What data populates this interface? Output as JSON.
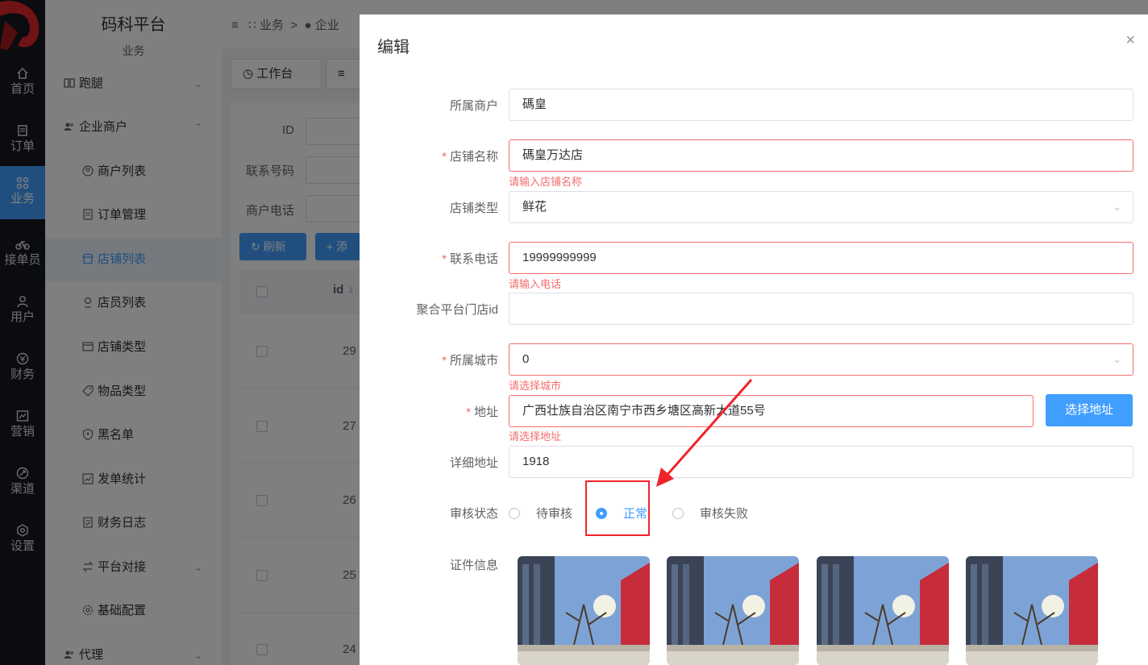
{
  "rail": {
    "items": [
      {
        "label": "首页",
        "icon": "home-icon"
      },
      {
        "label": "订单",
        "icon": "order-icon"
      },
      {
        "label": "业务",
        "icon": "grid-icon",
        "active": true
      },
      {
        "label": "接单员",
        "icon": "bike-icon"
      },
      {
        "label": "用户",
        "icon": "user-icon"
      },
      {
        "label": "财务",
        "icon": "finance-icon"
      },
      {
        "label": "营销",
        "icon": "chart-icon"
      },
      {
        "label": "渠道",
        "icon": "channel-icon"
      },
      {
        "label": "设置",
        "icon": "settings-icon"
      }
    ]
  },
  "sidebar": {
    "title": "码科平台",
    "subtitle": "业务",
    "groups": {
      "errand": "跑腿",
      "enterprise": "企业商户",
      "agent": "代理"
    },
    "items": [
      {
        "label": "商户列表"
      },
      {
        "label": "订单管理"
      },
      {
        "label": "店铺列表",
        "active": true
      },
      {
        "label": "店员列表"
      },
      {
        "label": "店铺类型"
      },
      {
        "label": "物品类型"
      },
      {
        "label": "黑名单"
      },
      {
        "label": "发单统计"
      },
      {
        "label": "财务日志"
      },
      {
        "label": "平台对接"
      },
      {
        "label": "基础配置"
      }
    ]
  },
  "breadcrumb": {
    "first": "业务",
    "separator": ">",
    "second": "企业"
  },
  "tabs": {
    "workbench": "工作台"
  },
  "filters": {
    "id_label": "ID",
    "phone_label": "联系号码",
    "merchant_phone_label": "商户电话"
  },
  "actions": {
    "refresh": "刷新",
    "add": "添"
  },
  "table": {
    "id_header": "id",
    "rows": [
      {
        "id": "29"
      },
      {
        "id": "27"
      },
      {
        "id": "26"
      },
      {
        "id": "25"
      },
      {
        "id": "24"
      }
    ]
  },
  "dialog": {
    "title": "编辑",
    "close": "×",
    "fields": {
      "merchant": {
        "label": "所属商户",
        "value": "碼皇"
      },
      "shop_name": {
        "label": "店铺名称",
        "value": "碼皇万达店",
        "error": "请输入店铺名称"
      },
      "shop_type": {
        "label": "店铺类型",
        "value": "鲜花"
      },
      "phone": {
        "label": "联系电话",
        "value": "19999999999",
        "error": "请输入电话"
      },
      "platform_store_id": {
        "label": "聚合平台门店id",
        "value": ""
      },
      "city": {
        "label": "所属城市",
        "value": "0",
        "error": "请选择城市"
      },
      "address": {
        "label": "地址",
        "value": "广西壮族自治区南宁市西乡塘区高新大道55号",
        "error": "请选择地址",
        "button": "选择地址"
      },
      "detail_address": {
        "label": "详细地址",
        "value": "1918"
      },
      "review_status": {
        "label": "审核状态",
        "options": [
          "待审核",
          "正常",
          "审核失败"
        ],
        "selected": "正常"
      },
      "certificates": {
        "label": "证件信息"
      }
    }
  },
  "colors": {
    "primary": "#409eff",
    "error": "#f56c6c",
    "annotation": "#f0232a",
    "rail_bg": "#16191e"
  }
}
